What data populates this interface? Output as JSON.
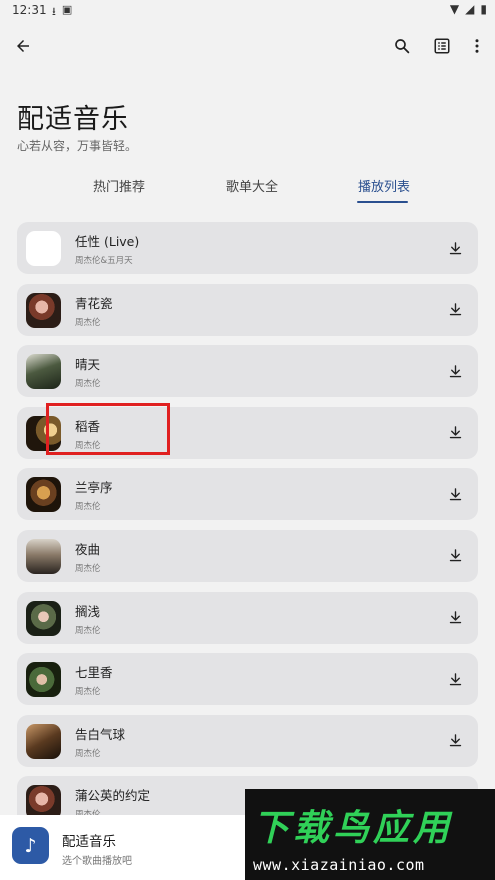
{
  "status_bar": {
    "time": "12:31"
  },
  "header": {
    "title": "配适音乐",
    "subtitle": "心若从容，万事皆轻。"
  },
  "tabs": [
    {
      "label": "热门推荐",
      "selected": false
    },
    {
      "label": "歌单大全",
      "selected": false
    },
    {
      "label": "播放列表",
      "selected": true
    }
  ],
  "songs": [
    {
      "title": "任性 (Live)",
      "artist": "周杰伦&五月天",
      "cover": "blank"
    },
    {
      "title": "青花瓷",
      "artist": "周杰伦",
      "cover": "photo"
    },
    {
      "title": "晴天",
      "artist": "周杰伦",
      "cover": "photo"
    },
    {
      "title": "稻香",
      "artist": "周杰伦",
      "cover": "photo"
    },
    {
      "title": "兰亭序",
      "artist": "周杰伦",
      "cover": "photo"
    },
    {
      "title": "夜曲",
      "artist": "周杰伦",
      "cover": "photo"
    },
    {
      "title": "搁浅",
      "artist": "周杰伦",
      "cover": "photo"
    },
    {
      "title": "七里香",
      "artist": "周杰伦",
      "cover": "photo"
    },
    {
      "title": "告白气球",
      "artist": "周杰伦",
      "cover": "photo"
    },
    {
      "title": "蒲公英的约定",
      "artist": "周杰伦",
      "cover": "photo"
    }
  ],
  "mini_player": {
    "title": "配适音乐",
    "subtitle": "选个歌曲播放吧"
  },
  "watermark": {
    "logo": "下载鸟应用",
    "url": "www.xiazainiao.com"
  },
  "colors": {
    "accent": "#2a4f8f",
    "card": "#e3e3e5",
    "highlight": "#e02020",
    "player_icon": "#2d5aa6",
    "watermark_green": "#30d158"
  }
}
